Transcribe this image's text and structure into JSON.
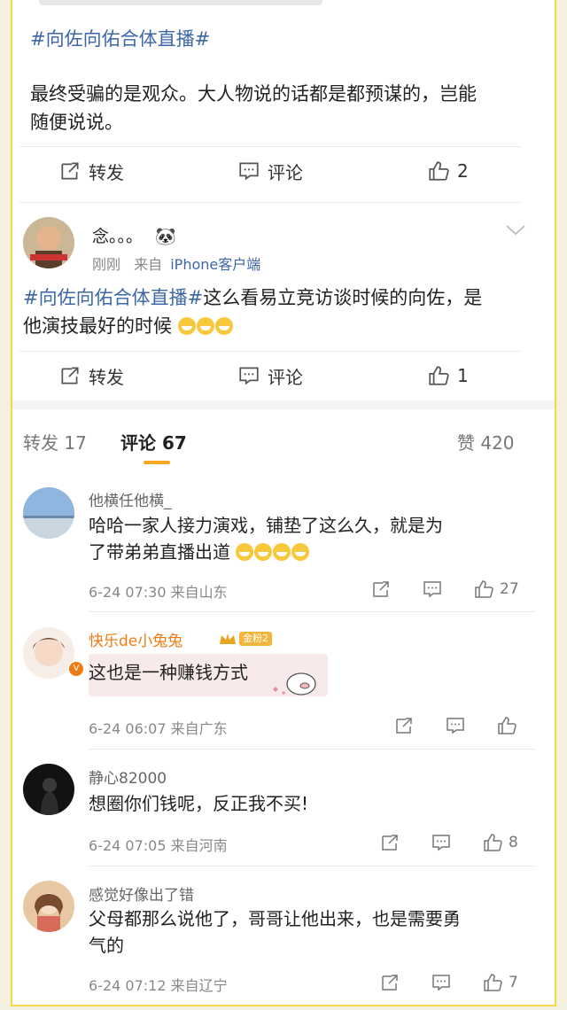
{
  "post1": {
    "hashtag": "#向佐向佑合体直播#",
    "text_line1": "最终受骗的是观众。大人物说的话都是都预谋的，岂能",
    "text_line2": "随便说说。",
    "actions": {
      "repost": "转发",
      "comment": "评论",
      "like_count": "2"
    }
  },
  "post2": {
    "username": "念。。。",
    "emoji": "🐼",
    "time": "刚刚",
    "source_prefix": "来自",
    "source": "iPhone客户端",
    "hashtag": "#向佐向佑合体直播#",
    "text_part1": "这么看易立竞访谈时候的向佐，是",
    "text_line2": "他演技最好的时候",
    "actions": {
      "repost": "转发",
      "comment": "评论",
      "like_count": "1"
    }
  },
  "tabs": {
    "repost": "转发 17",
    "comment": "评论 67",
    "likes": "赞 420"
  },
  "comments": [
    {
      "name": "他横任他横_",
      "line1": "哈哈一家人接力演戏，铺垫了这么久，就是为",
      "line2": "了带弟弟直播出道",
      "meta": "6-24 07:30  来自山东",
      "likes": "27"
    },
    {
      "name": "快乐de小兔兔",
      "badge_level": "金粉2",
      "line1": "这也是一种赚钱方式",
      "meta": "6-24 06:07  来自广东",
      "likes": ""
    },
    {
      "name": "静心82000",
      "line1": "想圈你们钱呢，反正我不买!",
      "meta": "6-24 07:05  来自河南",
      "likes": "8"
    },
    {
      "name": "感觉好像出了错",
      "line1": "父母都那么说他了，哥哥让他出来，也是需要勇",
      "line2": "气的",
      "meta": "6-24 07:12  来自辽宁",
      "likes": "7"
    }
  ],
  "colors": {
    "link": "#3d67a7",
    "accent": "#f5a623",
    "vip": "#f07a12",
    "frame": "#f2d84a"
  }
}
